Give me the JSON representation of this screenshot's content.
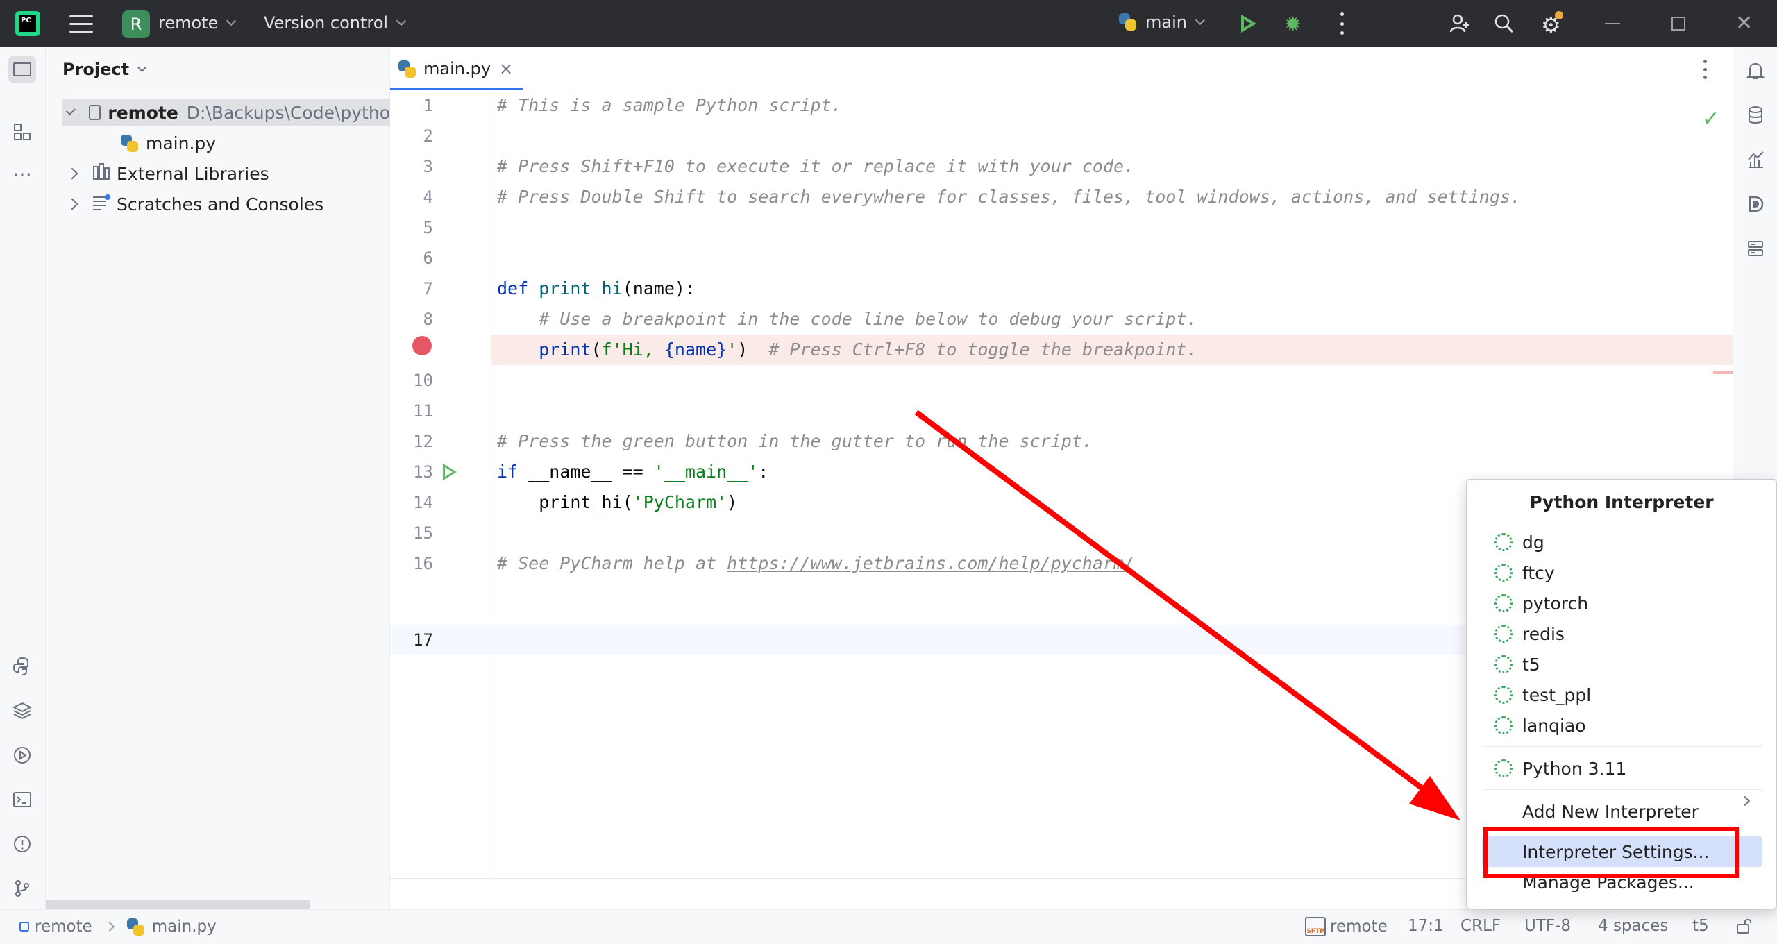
{
  "titlebar": {
    "project_badge": "R",
    "project_name": "remote",
    "vcs_label": "Version control",
    "run_config": "main"
  },
  "project_panel": {
    "header": "Project",
    "tree": [
      {
        "label": "remote",
        "path": "D:\\Backups\\Code\\pytho"
      },
      {
        "label": "main.py"
      },
      {
        "label": "External Libraries"
      },
      {
        "label": "Scratches and Consoles"
      }
    ]
  },
  "editor": {
    "tab_label": "main.py",
    "line_numbers": [
      "1",
      "2",
      "3",
      "4",
      "5",
      "6",
      "7",
      "8",
      "9",
      "10",
      "11",
      "12",
      "13",
      "14",
      "15",
      "16",
      "17"
    ],
    "lines": {
      "l1": "# This is a sample Python script.",
      "l3": "# Press Shift+F10 to execute it or replace it with your code.",
      "l4": "# Press Double Shift to search everywhere for classes, files, tool windows, actions, and settings.",
      "l7_kw": "def",
      "l7_fn": "print_hi",
      "l7_rest": "(name):",
      "l8": "    # Use a breakpoint in the code line below to debug your script.",
      "l9_indent": "    ",
      "l9_fn": "print",
      "l9_open": "(",
      "l9_str1": "f'Hi, ",
      "l9_mid": "{name}",
      "l9_str2": "'",
      "l9_close": ")",
      "l9_cmt": "  # Press Ctrl+F8 to toggle the breakpoint.",
      "l12": "# Press the green button in the gutter to run the script.",
      "l13_kw": "if",
      "l13_rest": " __name__ == ",
      "l13_str": "'__main__'",
      "l13_colon": ":",
      "l14_rest": "    print_hi(",
      "l14_str": "'PyCharm'",
      "l14_close": ")",
      "l16_cmt": "# See PyCharm help at ",
      "l16_link": "https://www.jetbrains.com/help/pycharm/"
    }
  },
  "popup": {
    "title": "Python Interpreter",
    "environments": [
      "dg",
      "ftcy",
      "pytorch",
      "redis",
      "t5",
      "test_ppl",
      "lanqiao"
    ],
    "system_interpreter": "Python 3.11",
    "add_new": "Add New Interpreter",
    "settings": "Interpreter Settings...",
    "manage": "Manage Packages..."
  },
  "statusbar": {
    "breadcrumb_project": "remote",
    "breadcrumb_file": "main.py",
    "sftp_label": "SFTP",
    "sftp_server": "remote",
    "position": "17:1",
    "line_ending": "CRLF",
    "encoding": "UTF-8",
    "indent": "4 spaces",
    "interpreter": "t5"
  },
  "colors": {
    "annotation": "#ff0000",
    "accent": "#3574f0",
    "run_green": "#5fb865",
    "breakpoint": "#e55765"
  }
}
